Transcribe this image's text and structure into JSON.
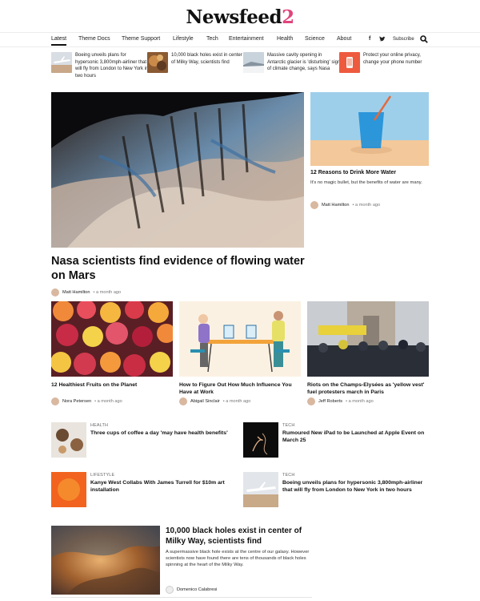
{
  "site": {
    "logo_text": "Newsfeed",
    "logo_num": "2"
  },
  "nav": {
    "items": [
      "Latest",
      "Theme Docs",
      "Theme Support",
      "Lifestyle",
      "Tech",
      "Entertainment",
      "Health",
      "Science",
      "About"
    ],
    "subscribe": "Subscribe",
    "facebook_icon": "f",
    "twitter_icon": "twitter-bird"
  },
  "mini_stories": [
    {
      "title": "Boeing unveils plans for hypersonic 3,800mph-airliner that will fly from London to New York in two hours"
    },
    {
      "title": "10,000 black holes exist in center of Milky Way, scientists find"
    },
    {
      "title": "Massive cavity opening in Antarctic glacier is 'disturbing' sign of climate change, says Nasa"
    },
    {
      "title": "Protect your online privacy, change your phone number"
    }
  ],
  "hero": {
    "title": "Nasa scientists find evidence of flowing water on Mars",
    "author": "Matt Hamilton",
    "time": "a month ago"
  },
  "side": {
    "title": "12 Reasons to Drink More Water",
    "desc": "It's no magic bullet, but the benefits of water are many.",
    "author": "Matt Hamilton",
    "time": "a month ago"
  },
  "cards": [
    {
      "title": "12 Healthiest Fruits on the Planet",
      "author": "Nora Petersen",
      "time": "a month ago"
    },
    {
      "title": "How to Figure Out How Much Influence You Have at Work",
      "author": "Abigail Sinclair",
      "time": "a month ago"
    },
    {
      "title": "Riots on the Champs-Elysées as 'yellow vest' fuel protesters march in Paris",
      "author": "Jeff Roberts",
      "time": "a month ago"
    }
  ],
  "list": [
    {
      "category": "HEALTH",
      "title": "Three cups of coffee a day 'may have health benefits'"
    },
    {
      "category": "TECH",
      "title": "Rumoured New iPad to be Launched at Apple Event on March 25"
    },
    {
      "category": "LIFESTYLE",
      "title": "Kanye West Collabs With James Turrell for $10m art installation"
    },
    {
      "category": "TECH",
      "title": "Boeing unveils plans for hypersonic 3,800mph-airliner that will fly from London to New York in two hours"
    }
  ],
  "feature": {
    "title": "10,000 black holes exist in center of Milky Way, scientists find",
    "desc": "A supermassive black hole exists at the centre of our galaxy. However scientists now have found there are tens of thousands of black holes spinning at the heart of the Milky Way.",
    "author": "Domenico Calabresi"
  },
  "colors": {
    "accent": "#e0457b"
  }
}
